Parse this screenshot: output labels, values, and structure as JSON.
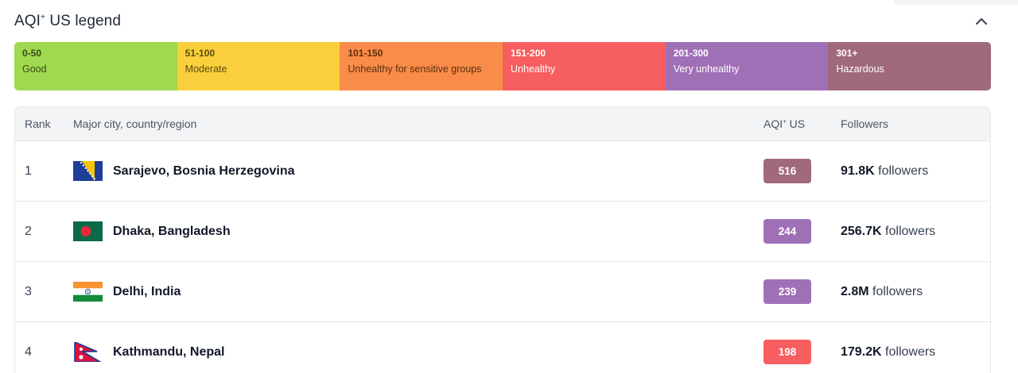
{
  "header": {
    "title_main": "AQI",
    "title_sup": "+",
    "title_suffix": " US legend"
  },
  "legend": [
    {
      "range": "0-50",
      "label": "Good",
      "color": "#9ed94f",
      "text_color": "#3f4a1a"
    },
    {
      "range": "51-100",
      "label": "Moderate",
      "color": "#f9cf3b",
      "text_color": "#5a4a14"
    },
    {
      "range": "101-150",
      "label": "Unhealthy for sensitive groups",
      "color": "#f88c48",
      "text_color": "#5c2e10"
    },
    {
      "range": "151-200",
      "label": "Unhealthy",
      "color": "#f65e5f",
      "text_color": "#ffffff"
    },
    {
      "range": "201-300",
      "label": "Very unhealthy",
      "color": "#a070b6",
      "text_color": "#ffffff"
    },
    {
      "range": "301+",
      "label": "Hazardous",
      "color": "#a06a7b",
      "text_color": "#ffffff"
    }
  ],
  "table": {
    "headers": {
      "rank": "Rank",
      "city": "Major city, country/region",
      "aqi_main": "AQI",
      "aqi_sup": "+",
      "aqi_suffix": " US",
      "followers": "Followers"
    },
    "rows": [
      {
        "rank": "1",
        "city": "Sarajevo, Bosnia Herzegovina",
        "flag": "bosnia-flag",
        "aqi": "516",
        "aqi_color": "#a06a7b",
        "followers_count": "91.8K",
        "followers_word": "followers"
      },
      {
        "rank": "2",
        "city": "Dhaka, Bangladesh",
        "flag": "bangladesh-flag",
        "aqi": "244",
        "aqi_color": "#a070b6",
        "followers_count": "256.7K",
        "followers_word": "followers"
      },
      {
        "rank": "3",
        "city": "Delhi, India",
        "flag": "india-flag",
        "aqi": "239",
        "aqi_color": "#a070b6",
        "followers_count": "2.8M",
        "followers_word": "followers"
      },
      {
        "rank": "4",
        "city": "Kathmandu, Nepal",
        "flag": "nepal-flag",
        "aqi": "198",
        "aqi_color": "#f65e5f",
        "followers_count": "179.2K",
        "followers_word": "followers"
      }
    ]
  }
}
